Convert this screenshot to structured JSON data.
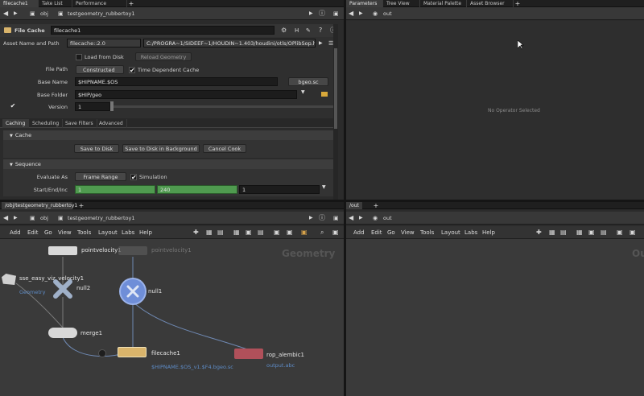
{
  "left_tabs": [
    "filecache1",
    "Take List",
    "Performance Monitor"
  ],
  "right_tabs": [
    "Parameters",
    "Tree View",
    "Material Palette",
    "Asset Browser"
  ],
  "top_path": {
    "context": "obj",
    "node": "testgeometry_rubbertoy1"
  },
  "right_path": {
    "node": "out"
  },
  "params": {
    "node_type": "File Cache",
    "node_name": "filecache1",
    "asset_label": "Asset Name and Path",
    "asset_name": "filecache::2.0",
    "asset_path": "C:/PROGRA~1/SIDEEF~1/HOUDIN~1.403/houdini/otls/OPlibSop.hda",
    "load_from_disk": "Load from Disk",
    "reload_geometry": "Reload Geometry",
    "file_path_label": "File Path",
    "file_path_mode": "Constructed",
    "time_dependent": "Time Dependent Cache",
    "base_name_label": "Base Name",
    "base_name": "$HIPNAME.$OS",
    "extension": "bgeo.sc",
    "base_folder_label": "Base Folder",
    "base_folder": "$HIP/geo",
    "version_label": "Version",
    "version": "1",
    "subtabs": [
      "Caching",
      "Scheduling",
      "Save Filters",
      "Advanced"
    ],
    "cache_section": "Cache",
    "save_to_disk": "Save to Disk",
    "save_bg": "Save to Disk in Background",
    "cancel_cook": "Cancel Cook",
    "sequence_section": "Sequence",
    "evaluate_as_label": "Evaluate As",
    "evaluate_as": "Frame Range",
    "simulation": "Simulation",
    "start_end_label": "Start/End/Inc",
    "start": "1",
    "end": "240",
    "inc": "1"
  },
  "right_params": {
    "message": "No Operator Selected"
  },
  "network_tabs": {
    "left": "/obj/testgeometry_rubbertoy1",
    "right": "/out"
  },
  "network_path": {
    "context": "obj",
    "node": "testgeometry_rubbertoy1"
  },
  "network_right_path": {
    "node": "out"
  },
  "menus": [
    "Add",
    "Edit",
    "Go",
    "View",
    "Tools",
    "Layout",
    "Labs",
    "Help"
  ],
  "network": {
    "context_label": "Geometry",
    "right_context_label": "Out",
    "nodes": {
      "pointvelocity1": "pointvelocity1",
      "pointvelocity1_ghost": "pointvelocity1",
      "sse_viz": "sse_easy_viz_velocity1",
      "sse_viz_sub": "Geometry",
      "null2": "null2",
      "null1": "null1",
      "merge1": "merge1",
      "filecache1": "filecache1",
      "filecache1_sub": "$HIPNAME.$OS_v1.$F4.bgeo.sc",
      "rop_alembic1": "rop_alembic1",
      "rop_alembic1_sub": "output.abc"
    }
  },
  "colors": {
    "accent": "#4f9a4f",
    "link": "#5e8cc7",
    "rop": "#b0505a",
    "filecache": "#d9b46b"
  }
}
